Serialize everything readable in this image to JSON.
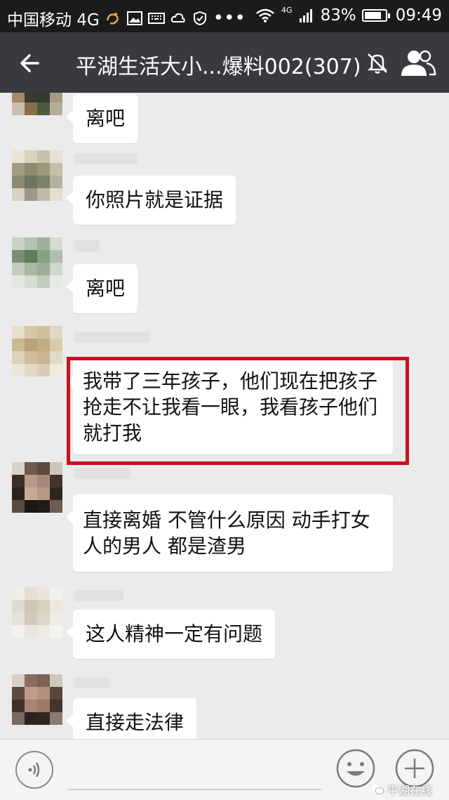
{
  "status_bar": {
    "carrier": "中国移动 4G",
    "network_small": "4G",
    "battery": "83%",
    "battery_level": 0.83,
    "time": "09:49"
  },
  "header": {
    "title": "平湖生活大小...爆料002(307)"
  },
  "messages": [
    {
      "text": "离吧"
    },
    {
      "text": "你照片就是证据"
    },
    {
      "text": "离吧"
    },
    {
      "lines": [
        "我带了三年孩子，他们现在把孩子",
        "抢走不让我看一眼，我看孩子他们",
        "就打我"
      ],
      "highlighted": true
    },
    {
      "lines": [
        "直接离婚 不管什么原因 动手打女",
        "人的男人  都是渣男"
      ]
    },
    {
      "text": "这人精神一定有问题"
    },
    {
      "text": "直接走法律"
    }
  ],
  "watermark": "平湖在线",
  "colors": {
    "header": "#393a3f",
    "statusbar": "#1b1b1b",
    "highlight": "#c8121e",
    "chat_bg": "#ebebeb"
  }
}
